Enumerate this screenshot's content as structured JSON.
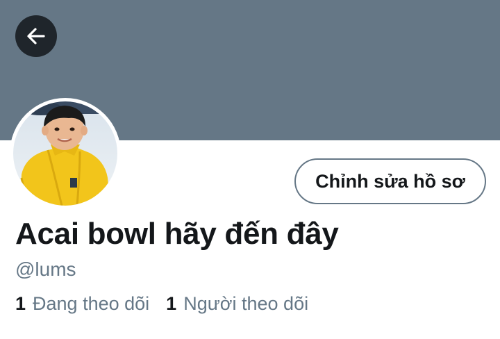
{
  "colors": {
    "banner": "#657786",
    "back_button_bg": "#1f252b",
    "text_primary": "#14171a",
    "text_secondary": "#657786",
    "button_border": "#657786",
    "avatar_jacket": "#f2c51b"
  },
  "header": {
    "back_icon": "arrow-left-icon"
  },
  "profile": {
    "avatar_alt": "profile photo",
    "edit_button_label": "Chỉnh sửa hồ sơ",
    "display_name": "Acai bowl hãy đến đây",
    "handle": "@lums",
    "following_count": "1",
    "following_label": "Đang theo dõi",
    "followers_count": "1",
    "followers_label": "Người theo dõi"
  }
}
